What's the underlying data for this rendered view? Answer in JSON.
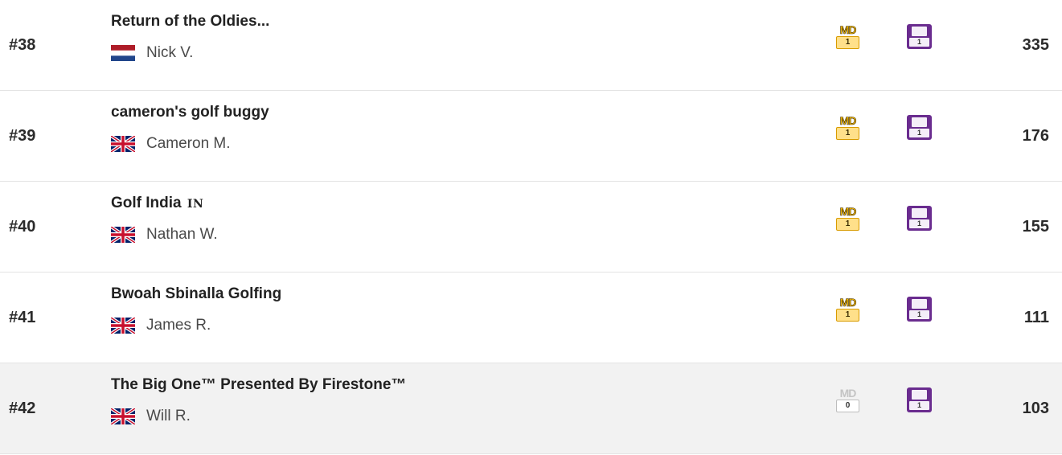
{
  "rows": [
    {
      "rank": "#38",
      "team": "Return of the Oldies...",
      "team_tag": "",
      "manager": "Nick V.",
      "flag": "NL",
      "md_label": "MD",
      "md_value": "1",
      "md_active": true,
      "gw_value": "1",
      "score": "335",
      "highlight": false
    },
    {
      "rank": "#39",
      "team": "cameron's golf buggy",
      "team_tag": "",
      "manager": "Cameron M.",
      "flag": "GB",
      "md_label": "MD",
      "md_value": "1",
      "md_active": true,
      "gw_value": "1",
      "score": "176",
      "highlight": false
    },
    {
      "rank": "#40",
      "team": "Golf India",
      "team_tag": "IN",
      "manager": "Nathan W.",
      "flag": "GB",
      "md_label": "MD",
      "md_value": "1",
      "md_active": true,
      "gw_value": "1",
      "score": "155",
      "highlight": false
    },
    {
      "rank": "#41",
      "team": "Bwoah Sbinalla Golfing",
      "team_tag": "",
      "manager": "James R.",
      "flag": "GB",
      "md_label": "MD",
      "md_value": "1",
      "md_active": true,
      "gw_value": "1",
      "score": "111",
      "highlight": false
    },
    {
      "rank": "#42",
      "team": "The Big One™ Presented By Firestone™",
      "team_tag": "",
      "manager": "Will R.",
      "flag": "GB",
      "md_label": "MD",
      "md_value": "0",
      "md_active": false,
      "gw_value": "1",
      "score": "103",
      "highlight": true
    }
  ],
  "colors": {
    "md_gold": "#f2b705",
    "md_grey": "#c4c4c4",
    "gw_purple": "#6a2c8f",
    "highlight_row": "#f2f2f2"
  }
}
